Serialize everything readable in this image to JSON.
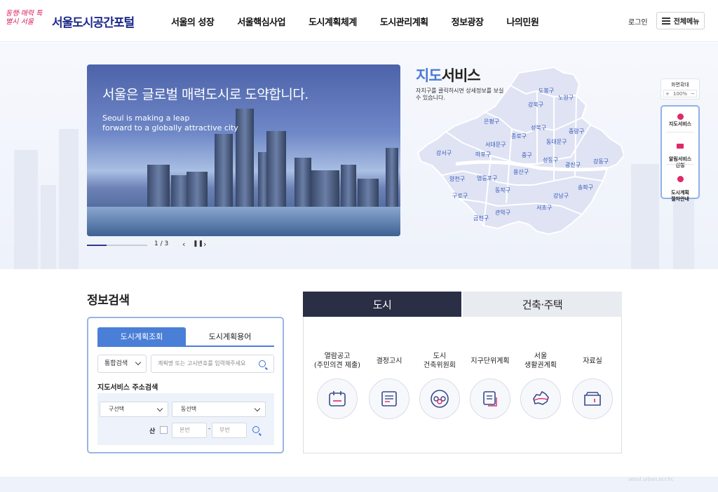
{
  "header": {
    "logo_sub": "동행·매력 특별시 서울",
    "logo_main": "서울도시공간포털",
    "nav": [
      "서울의 성장",
      "서울핵심사업",
      "도시계획체계",
      "도시관리계획",
      "정보광장",
      "나의민원"
    ],
    "login": "로그인",
    "all_menu": "전체메뉴"
  },
  "banner": {
    "title": "서울은 글로벌 매력도시로 도약합니다.",
    "subtitle_en": "Seoul is making a leap\nforward to a globally attractive city",
    "page_indicator": "1 / 3",
    "progress": 0.33
  },
  "map": {
    "title_accent": "지도",
    "title_rest": "서비스",
    "description": "자치구를 클릭하시면 상세정보를 보실 수 있습니다.",
    "districts": [
      "도봉구",
      "노원구",
      "강북구",
      "은평구",
      "성북구",
      "중랑구",
      "종로구",
      "서대문구",
      "동대문구",
      "마포구",
      "중구",
      "강서구",
      "성동구",
      "광진구",
      "강동구",
      "용산구",
      "양천구",
      "영등포구",
      "동작구",
      "구로구",
      "송파구",
      "강남구",
      "서초구",
      "금천구",
      "관악구"
    ]
  },
  "quick": {
    "zoom_label": "화면확대",
    "zoom_value": "100%",
    "zoom_plus": "+",
    "zoom_minus": "−",
    "items": [
      "지도서비스",
      "알림서비스\n신청",
      "도시계획\n절차안내"
    ],
    "colors": {
      "icon": "#e0286a"
    }
  },
  "search": {
    "section_title": "정보검색",
    "tab_active": "도시계획조회",
    "tab_inactive": "도시계획용어",
    "type_select": "통합검색",
    "keyword_placeholder": "계획명 또는 고시번호를 입력해주세요",
    "address_title": "지도서비스 주소검색",
    "gu_select": "구선택",
    "dong_select": "동선택",
    "san_label": "산",
    "main_number_placeholder": "본번",
    "sub_number_placeholder": "부번",
    "dash": "-"
  },
  "city": {
    "tab_active": "도시",
    "tab_inactive": "건축·주택",
    "items": [
      {
        "label": "열람공고\n(주민의견 제출)",
        "icon": "calendar-icon"
      },
      {
        "label": "결정고시",
        "icon": "document-icon"
      },
      {
        "label": "도시\n건축위원회",
        "icon": "committee-icon"
      },
      {
        "label": "지구단위계획",
        "icon": "plan-icon"
      },
      {
        "label": "서울\n생활권계획",
        "icon": "seoul-map-icon"
      },
      {
        "label": "자료실",
        "icon": "archive-icon"
      }
    ]
  },
  "colors": {
    "brand": "#1c2a8a",
    "accent_blue": "#4a7fd8",
    "dark_tab": "#2b2f45",
    "district_fill": "#dfe3f3"
  },
  "watermark": "seoul.urban.ocr.hc"
}
